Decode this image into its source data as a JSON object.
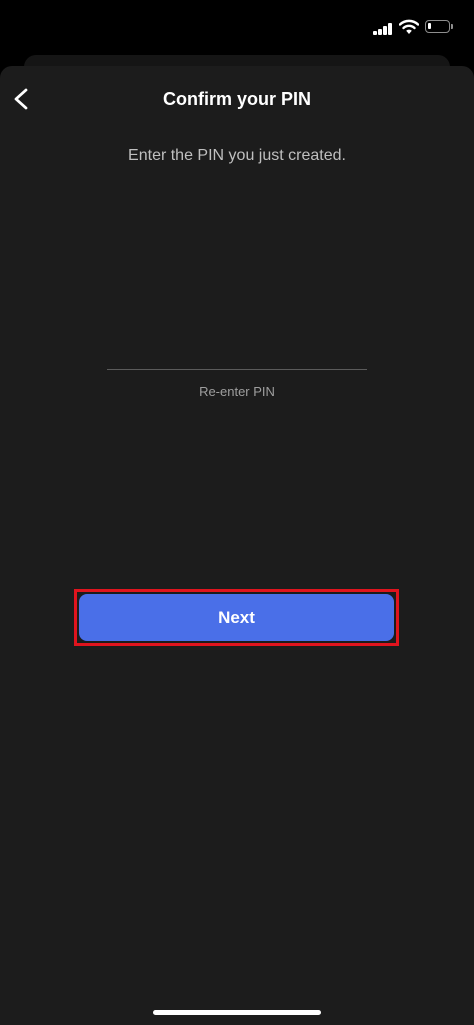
{
  "status_bar": {
    "signal_icon": "cellular-signal-icon",
    "wifi_icon": "wifi-icon",
    "battery_icon": "battery-icon",
    "battery_level": 0.15
  },
  "header": {
    "back_icon": "chevron-left-icon",
    "title": "Confirm your PIN"
  },
  "main": {
    "subtitle": "Enter the PIN you just created.",
    "pin_field": {
      "value": "",
      "label": "Re-enter PIN"
    },
    "next_label": "Next"
  },
  "colors": {
    "background": "#1c1c1c",
    "accent": "#4a6fe8",
    "highlight": "#e0141e",
    "text_primary": "#ffffff",
    "text_secondary": "#bfbfbf"
  }
}
